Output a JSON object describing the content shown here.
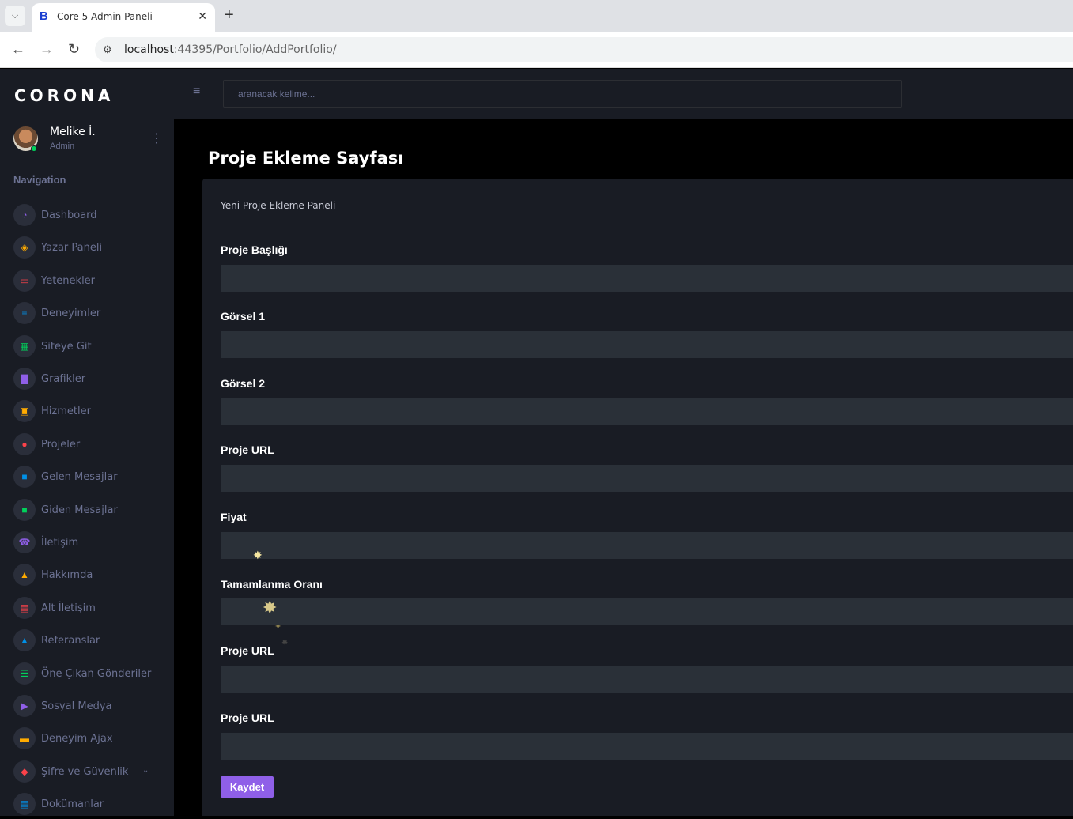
{
  "browser": {
    "tab_title": "Core 5 Admin Paneli",
    "tab_favicon": "B",
    "url_host": "localhost",
    "url_path": ":44395/Portfolio/AddPortfolio/"
  },
  "sidebar": {
    "brand": "CORONA",
    "profile": {
      "name": "Melike İ.",
      "role": "Admin"
    },
    "nav_heading": "Navigation",
    "items": [
      {
        "label": "Dashboard",
        "icon": "speedometer-icon",
        "color": "#8f5fe8"
      },
      {
        "label": "Yazar Paneli",
        "icon": "cube-icon",
        "color": "#ffab00"
      },
      {
        "label": "Yetenekler",
        "icon": "laptop-icon",
        "color": "#fc424a"
      },
      {
        "label": "Deneyimler",
        "icon": "list-icon",
        "color": "#0090e7"
      },
      {
        "label": "Siteye Git",
        "icon": "table-icon",
        "color": "#00d25b"
      },
      {
        "label": "Grafikler",
        "icon": "chart-icon",
        "color": "#8f5fe8"
      },
      {
        "label": "Hizmetler",
        "icon": "contact-card-icon",
        "color": "#ffab00"
      },
      {
        "label": "Projeler",
        "icon": "github-icon",
        "color": "#fc424a"
      },
      {
        "label": "Gelen Mesajlar",
        "icon": "chat-icon",
        "color": "#0090e7"
      },
      {
        "label": "Giden Mesajlar",
        "icon": "message-icon",
        "color": "#00d25b"
      },
      {
        "label": "İletişim",
        "icon": "phone-icon",
        "color": "#8f5fe8"
      },
      {
        "label": "Hakkımda",
        "icon": "person-icon",
        "color": "#ffab00"
      },
      {
        "label": "Alt İletişim",
        "icon": "calendar-icon",
        "color": "#fc424a"
      },
      {
        "label": "Referanslar",
        "icon": "user-icon",
        "color": "#0090e7"
      },
      {
        "label": "Öne Çıkan Gönderiler",
        "icon": "format-list-icon",
        "color": "#00d25b"
      },
      {
        "label": "Sosyal Medya",
        "icon": "youtube-icon",
        "color": "#8f5fe8"
      },
      {
        "label": "Deneyim Ajax",
        "icon": "car-icon",
        "color": "#ffab00"
      },
      {
        "label": "Şifre ve Güvenlik",
        "icon": "shield-icon",
        "color": "#fc424a"
      },
      {
        "label": "Dokümanlar",
        "icon": "document-icon",
        "color": "#0090e7"
      }
    ]
  },
  "topnav": {
    "search_placeholder": "aranacak kelime..."
  },
  "main": {
    "page_title": "Proje Ekleme Sayfası",
    "card_description": "Yeni Proje Ekleme Paneli",
    "fields": [
      {
        "label": "Proje Başlığı",
        "value": ""
      },
      {
        "label": "Görsel 1",
        "value": ""
      },
      {
        "label": "Görsel 2",
        "value": ""
      },
      {
        "label": "Proje URL",
        "value": ""
      },
      {
        "label": "Fiyat",
        "value": ""
      },
      {
        "label": "Tamamlanma Oranı",
        "value": ""
      },
      {
        "label": "Proje URL",
        "value": ""
      },
      {
        "label": "Proje URL",
        "value": ""
      }
    ],
    "save_label": "Kaydet"
  }
}
